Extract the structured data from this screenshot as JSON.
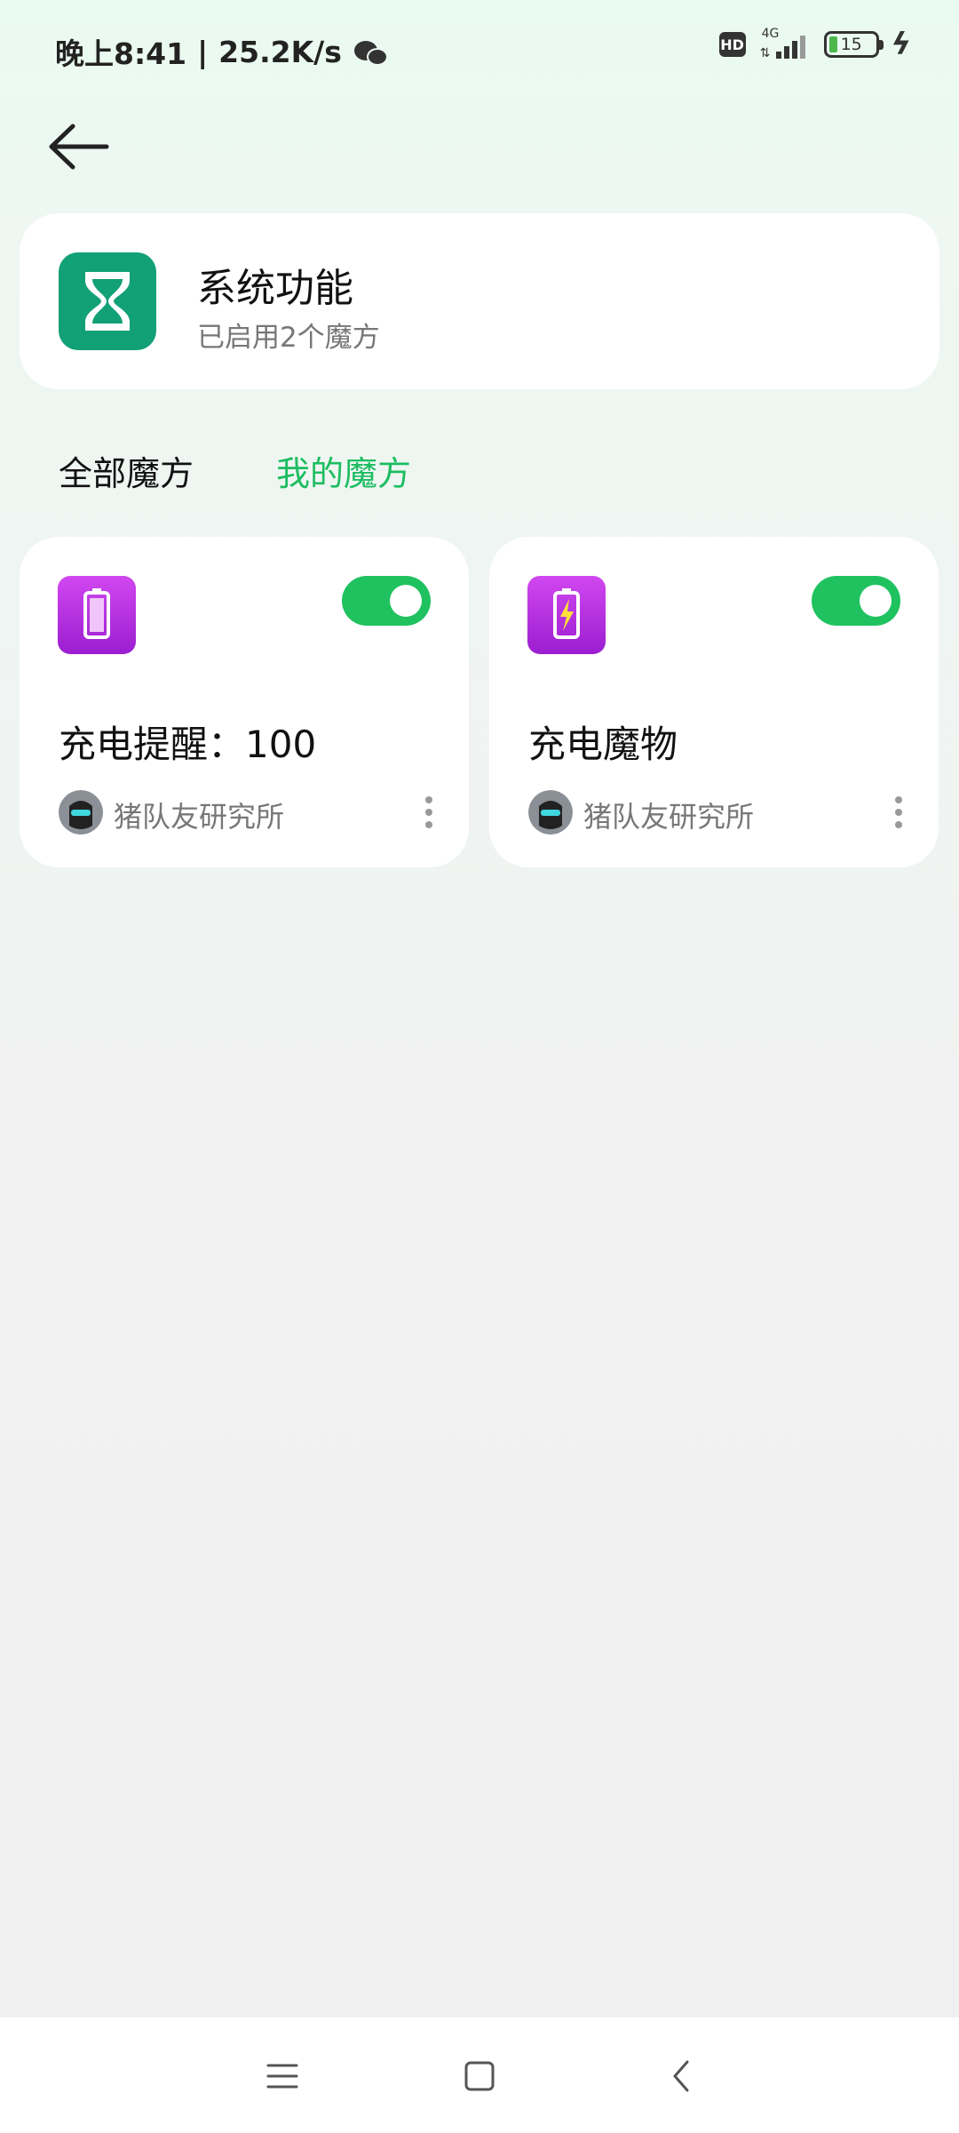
{
  "status_bar": {
    "time": "晚上8:41",
    "separator": "|",
    "speed": "25.2K/s",
    "hd_label": "HD",
    "network": "4G",
    "battery": "15",
    "icons": [
      "wechat-icon",
      "hd-icon",
      "signal-icon",
      "battery-icon",
      "charging-icon"
    ]
  },
  "header": {
    "title": "系统功能",
    "subtitle": "已启用2个魔方",
    "icon": "hourglass-icon",
    "icon_color": "#12a077"
  },
  "tabs": [
    {
      "label": "全部魔方",
      "active": false
    },
    {
      "label": "我的魔方",
      "active": true
    }
  ],
  "cards": [
    {
      "title": "充电提醒：100",
      "author": "猪队友研究所",
      "enabled": true,
      "icon": "battery-icon"
    },
    {
      "title": "充电魔物",
      "author": "猪队友研究所",
      "enabled": true,
      "icon": "battery-charging-icon"
    }
  ],
  "colors": {
    "accent": "#1dbd61",
    "toggle_on": "#1fc25f",
    "card_icon": "#b02fe0"
  },
  "nav": {
    "icons": [
      "menu-icon",
      "home-icon",
      "back-icon"
    ]
  }
}
